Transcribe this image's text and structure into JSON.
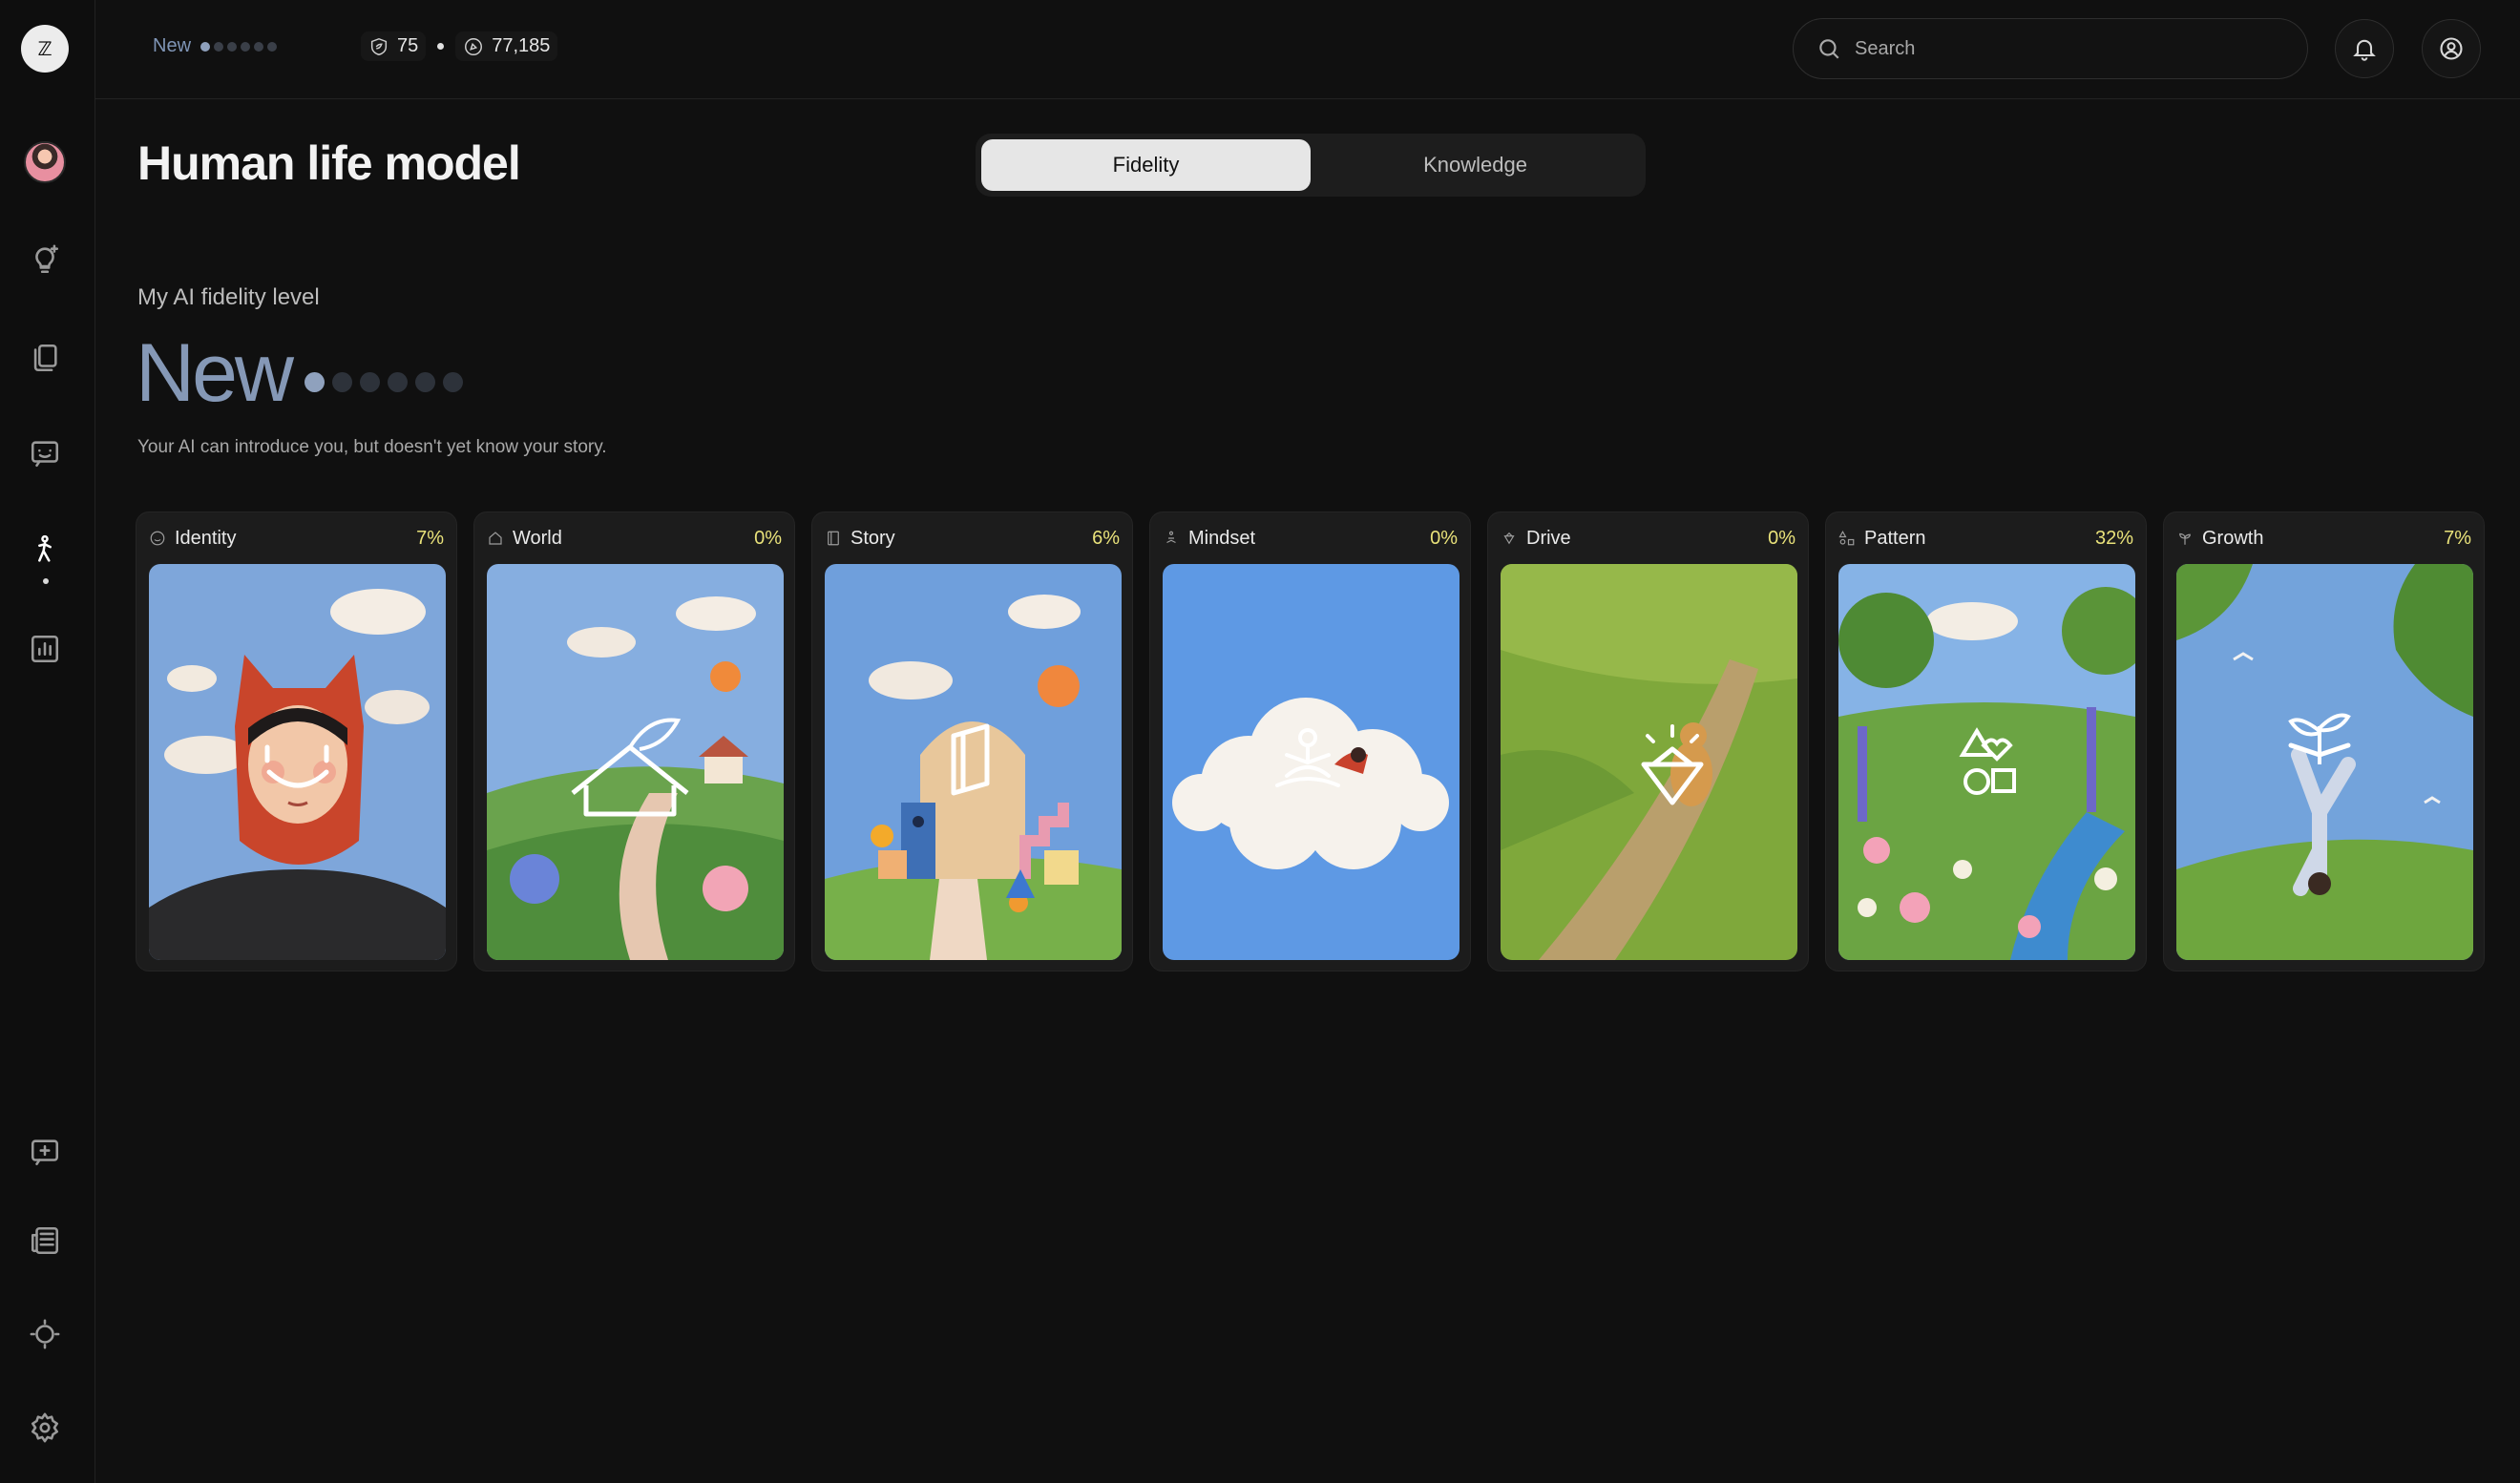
{
  "sidebar": {
    "logo_text": "ℤ",
    "items": [
      {
        "name": "profile-avatar",
        "icon": "avatar"
      },
      {
        "name": "ideas",
        "icon": "lightbulb-sparkle-icon"
      },
      {
        "name": "library",
        "icon": "stack-icon"
      },
      {
        "name": "chat",
        "icon": "smile-chat-icon"
      },
      {
        "name": "life-model",
        "icon": "person-icon",
        "active": true
      },
      {
        "name": "stats",
        "icon": "bar-chart-icon"
      },
      {
        "name": "new-chat",
        "icon": "add-chat-icon"
      },
      {
        "name": "news",
        "icon": "newspaper-icon"
      },
      {
        "name": "theme",
        "icon": "sun-icon"
      },
      {
        "name": "settings",
        "icon": "gear-icon"
      }
    ]
  },
  "topbar": {
    "level": "New",
    "level_dots_filled": 1,
    "level_dots_total": 6,
    "stat_one": "75",
    "stat_two": "77,185",
    "search_placeholder": "Search"
  },
  "page": {
    "title": "Human life model",
    "tabs": [
      {
        "label": "Fidelity",
        "active": true
      },
      {
        "label": "Knowledge",
        "active": false
      }
    ]
  },
  "fidelity": {
    "label": "My AI fidelity level",
    "level": "New",
    "dots_filled": 1,
    "dots_total": 6,
    "description": "Your AI can introduce you, but doesn't yet know your story."
  },
  "cards": [
    {
      "title": "Identity",
      "percent": "7%",
      "icon": "smile-icon"
    },
    {
      "title": "World",
      "percent": "0%",
      "icon": "house-icon"
    },
    {
      "title": "Story",
      "percent": "6%",
      "icon": "book-icon"
    },
    {
      "title": "Mindset",
      "percent": "0%",
      "icon": "meditate-icon"
    },
    {
      "title": "Drive",
      "percent": "0%",
      "icon": "diamond-icon"
    },
    {
      "title": "Pattern",
      "percent": "32%",
      "icon": "shapes-icon"
    },
    {
      "title": "Growth",
      "percent": "7%",
      "icon": "sprout-icon"
    }
  ],
  "colors": {
    "accent_percent": "#e9e27a",
    "level_blue": "#8598b6"
  }
}
